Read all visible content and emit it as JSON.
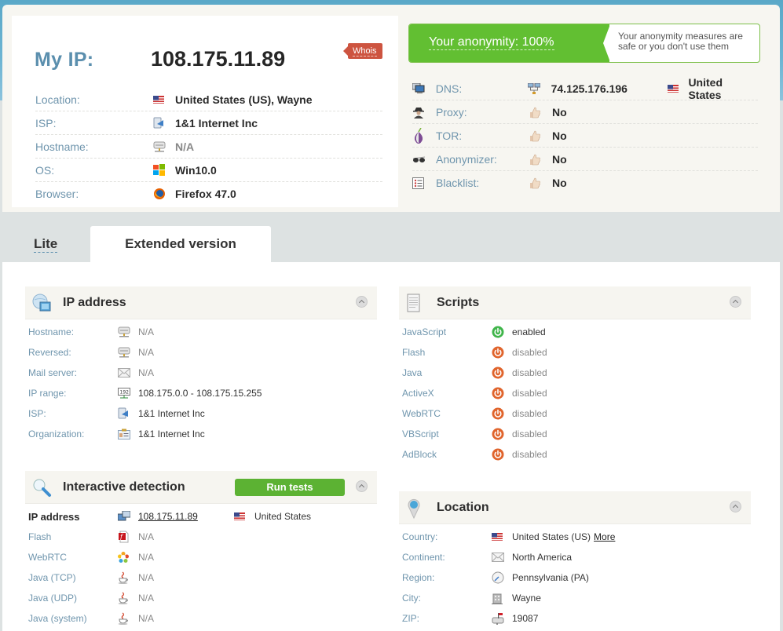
{
  "summary": {
    "my_ip_label": "My IP:",
    "my_ip_value": "108.175.11.89",
    "whois_label": "Whois",
    "rows": [
      {
        "label": "Location:",
        "icon": "us-flag-icon",
        "value": "United States (US), Wayne"
      },
      {
        "label": "ISP:",
        "icon": "isp-icon",
        "value": "1&1 Internet Inc"
      },
      {
        "label": "Hostname:",
        "icon": "server-icon",
        "value": "N/A"
      },
      {
        "label": "OS:",
        "icon": "windows-icon",
        "value": "Win10.0"
      },
      {
        "label": "Browser:",
        "icon": "firefox-icon",
        "value": "Firefox 47.0"
      }
    ]
  },
  "anonymity": {
    "title": "Your anonymity: 100%",
    "percent": 100,
    "description": "Your anonymity measures are safe or you don't use them",
    "accent": "#62bf32",
    "rows": [
      {
        "label": "DNS:",
        "icon": "dns-icon",
        "value": "74.125.176.196",
        "country": "United States"
      },
      {
        "label": "Proxy:",
        "icon": "proxy-icon",
        "value": "No"
      },
      {
        "label": "TOR:",
        "icon": "tor-icon",
        "value": "No"
      },
      {
        "label": "Anonymizer:",
        "icon": "anonymizer-icon",
        "value": "No"
      },
      {
        "label": "Blacklist:",
        "icon": "blacklist-icon",
        "value": "No"
      }
    ]
  },
  "tabs": {
    "lite": "Lite",
    "extended": "Extended version",
    "active": "extended"
  },
  "ip_section": {
    "title": "IP address",
    "rows": [
      {
        "label": "Hostname:",
        "value": "N/A"
      },
      {
        "label": "Reversed:",
        "value": "N/A"
      },
      {
        "label": "Mail server:",
        "value": "N/A"
      },
      {
        "label": "IP range:",
        "value": "108.175.0.0 - 108.175.15.255"
      },
      {
        "label": "ISP:",
        "value": "1&1 Internet Inc"
      },
      {
        "label": "Organization:",
        "value": "1&1 Internet Inc"
      }
    ]
  },
  "scripts_section": {
    "title": "Scripts",
    "enabled_color": "#3fb54a",
    "disabled_color": "#e0642c",
    "rows": [
      {
        "label": "JavaScript",
        "value": "enabled"
      },
      {
        "label": "Flash",
        "value": "disabled"
      },
      {
        "label": "Java",
        "value": "disabled"
      },
      {
        "label": "ActiveX",
        "value": "disabled"
      },
      {
        "label": "WebRTC",
        "value": "disabled"
      },
      {
        "label": "VBScript",
        "value": "disabled"
      },
      {
        "label": "AdBlock",
        "value": "disabled"
      }
    ]
  },
  "interactive_section": {
    "title": "Interactive detection",
    "run_button": "Run tests",
    "rows": [
      {
        "label": "IP address",
        "value": "108.175.11.89",
        "country": "United States"
      },
      {
        "label": "Flash",
        "value": "N/A"
      },
      {
        "label": "WebRTC",
        "value": "N/A"
      },
      {
        "label": "Java (TCP)",
        "value": "N/A"
      },
      {
        "label": "Java (UDP)",
        "value": "N/A"
      },
      {
        "label": "Java (system)",
        "value": "N/A"
      }
    ]
  },
  "location_section": {
    "title": "Location",
    "more_link": "More",
    "rows": [
      {
        "label": "Country:",
        "value": "United States (US)"
      },
      {
        "label": "Continent:",
        "value": "North America"
      },
      {
        "label": "Region:",
        "value": "Pennsylvania (PA)"
      },
      {
        "label": "City:",
        "value": "Wayne"
      },
      {
        "label": "ZIP:",
        "value": "19087"
      }
    ]
  }
}
